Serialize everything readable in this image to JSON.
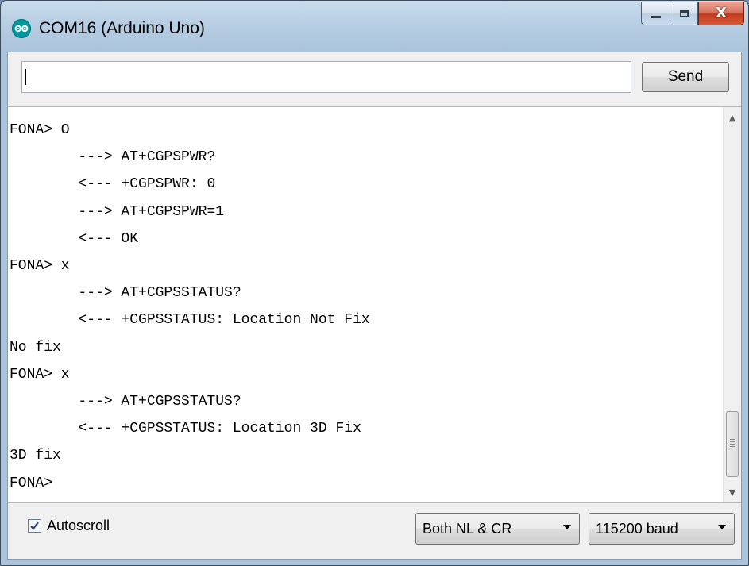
{
  "window": {
    "title": "COM16 (Arduino Uno)",
    "icon": "arduino-logo-icon",
    "accent_color": "#00979c",
    "controls": {
      "minimize": "minimize-icon",
      "maximize": "maximize-icon",
      "close_glyph": "X"
    }
  },
  "input": {
    "value": "",
    "send_label": "Send"
  },
  "serial_output": {
    "lines": [
      "FONA> O",
      "        ---> AT+CGPSPWR?",
      "        <--- +CGPSPWR: 0",
      "        ---> AT+CGPSPWR=1",
      "        <--- OK",
      "FONA> x",
      "        ---> AT+CGPSSTATUS?",
      "        <--- +CGPSSTATUS: Location Not Fix",
      "No fix",
      "FONA> x",
      "        ---> AT+CGPSSTATUS?",
      "        <--- +CGPSSTATUS: Location 3D Fix",
      "3D fix",
      "FONA>"
    ]
  },
  "bottom": {
    "autoscroll_label": "Autoscroll",
    "autoscroll_checked": true,
    "line_ending": "Both NL & CR",
    "baud_rate": "115200 baud"
  }
}
